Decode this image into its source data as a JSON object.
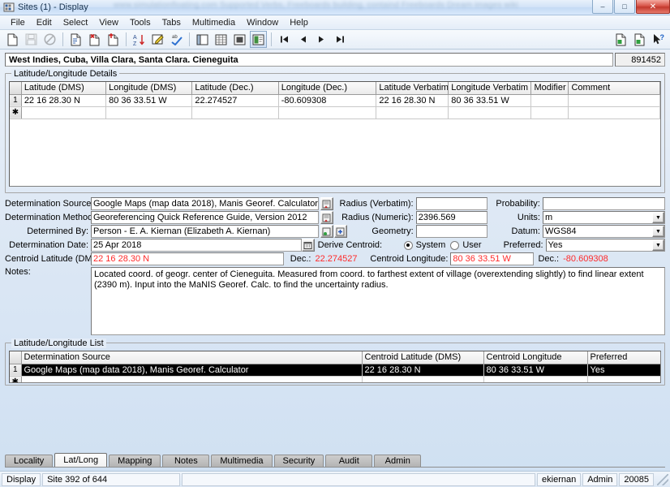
{
  "window": {
    "title": "Sites (1) - Display",
    "app_icon": "specify-app-icon",
    "watermark": "www.simulationfloating.com  Supported Verbs, Freeboards building, containd  Freeboards Dream  images wiki",
    "controls": [
      {
        "name": "minimize",
        "glyph": "–"
      },
      {
        "name": "maximize",
        "glyph": "□"
      },
      {
        "name": "close",
        "glyph": "✕"
      }
    ]
  },
  "menubar": {
    "items": [
      {
        "label": "File"
      },
      {
        "label": "Edit"
      },
      {
        "label": "Select"
      },
      {
        "label": "View"
      },
      {
        "label": "Tools"
      },
      {
        "label": "Tabs"
      },
      {
        "label": "Multimedia"
      },
      {
        "label": "Window"
      },
      {
        "label": "Help"
      }
    ]
  },
  "toolbar": {
    "buttons": [
      {
        "name": "new-record-icon",
        "title": "New"
      },
      {
        "name": "save-record-icon",
        "title": "Save"
      },
      {
        "name": "cancel-icon",
        "title": "Cancel"
      },
      {
        "name": "duplicate-record-icon",
        "title": "Duplicate"
      },
      {
        "name": "delete-record-icon",
        "title": "Delete"
      },
      {
        "name": "remove-record-icon",
        "title": "Remove"
      },
      {
        "name": "sort-icon",
        "title": "Sort"
      },
      {
        "name": "edit-query-icon",
        "title": "Edit Query"
      },
      {
        "name": "spellcheck-icon",
        "title": "Spell Check"
      },
      {
        "name": "form-view-icon",
        "title": "Form View"
      },
      {
        "name": "grid-view-icon",
        "title": "Grid View"
      },
      {
        "name": "report-view-icon",
        "title": "Report View"
      },
      {
        "name": "record-view-icon",
        "title": "Record View"
      },
      {
        "name": "nav-first-icon",
        "title": "First"
      },
      {
        "name": "nav-prev-icon",
        "title": "Previous"
      },
      {
        "name": "nav-next-icon",
        "title": "Next"
      },
      {
        "name": "nav-last-icon",
        "title": "Last"
      }
    ],
    "right_buttons": [
      {
        "name": "export-record-icon",
        "title": "Export"
      },
      {
        "name": "import-record-icon",
        "title": "Import"
      },
      {
        "name": "context-help-icon",
        "title": "Context Help"
      }
    ]
  },
  "header": {
    "locality": "West Indies, Cuba, Villa Clara, Santa Clara. Cieneguita",
    "record_id": "891452"
  },
  "details_group": {
    "title": "Latitude/Longitude Details",
    "columns": [
      "Latitude (DMS)",
      "Longitude (DMS)",
      "Latitude (Dec.)",
      "Longitude (Dec.)",
      "Latitude Verbatim",
      "Longitude Verbatim",
      "Modifier",
      "Comment"
    ],
    "rows": [
      {
        "num": "1",
        "cells": [
          "22 16 28.30 N",
          "80 36 33.51 W",
          "22.274527",
          "-80.609308",
          "22 16 28.30 N",
          "80 36 33.51 W",
          "",
          ""
        ]
      }
    ],
    "new_row_marker": "✱"
  },
  "form": {
    "determination_source": {
      "label": "Determination Source:",
      "value": "Google Maps (map data 2018), Manis Georef. Calculator"
    },
    "determination_method": {
      "label": "Determination Method:",
      "value": "Georeferencing Quick Reference Guide, Version 2012"
    },
    "determined_by": {
      "label": "Determined By:",
      "value": "Person - E. A. Kiernan (Elizabeth A. Kiernan)"
    },
    "determination_date": {
      "label": "Determination Date:",
      "value": "25 Apr 2018"
    },
    "centroid_latitude_dms": {
      "label": "Centroid Latitude (DMS):",
      "value": "22 16 28.30 N"
    },
    "centroid_latitude_dec": {
      "label": "Dec.:",
      "value": "22.274527"
    },
    "centroid_longitude_dms": {
      "label": "Centroid Longitude:",
      "value": "80 36 33.51 W"
    },
    "centroid_longitude_dec": {
      "label": "Dec.:",
      "value": "-80.609308"
    },
    "radius_verbatim": {
      "label": "Radius (Verbatim):",
      "value": ""
    },
    "radius_numeric": {
      "label": "Radius (Numeric):",
      "value": "2396.569"
    },
    "geometry": {
      "label": "Geometry:",
      "value": ""
    },
    "derive_centroid": {
      "label": "Derive Centroid:",
      "option_system": "System",
      "option_user": "User",
      "selected": "System"
    },
    "probability": {
      "label": "Probability:",
      "value": ""
    },
    "units": {
      "label": "Units:",
      "value": "m"
    },
    "datum": {
      "label": "Datum:",
      "value": "WGS84"
    },
    "preferred": {
      "label": "Preferred:",
      "value": "Yes"
    },
    "notes": {
      "label": "Notes:",
      "value": "Located coord. of geogr. center of Cieneguita. Measured from coord. to farthest extent of village (overextending slightly) to find linear extent (2390 m). Input into the MaNIS Georef. Calc. to find the uncertainty radius."
    }
  },
  "list_group": {
    "title": "Latitude/Longitude List",
    "columns": [
      "Determination Source",
      "Centroid Latitude (DMS)",
      "Centroid Longitude",
      "Preferred"
    ],
    "rows": [
      {
        "num": "1",
        "selected": true,
        "cells": [
          "Google Maps (map data 2018), Manis Georef. Calculator",
          "22 16 28.30 N",
          "80 36 33.51 W",
          "Yes"
        ]
      }
    ],
    "new_row_marker": "✱"
  },
  "tabs": {
    "items": [
      {
        "label": "Locality",
        "active": false
      },
      {
        "label": "Lat/Long",
        "active": true
      },
      {
        "label": "Mapping",
        "active": false
      },
      {
        "label": "Notes",
        "active": false
      },
      {
        "label": "Multimedia",
        "active": false
      },
      {
        "label": "Security",
        "active": false
      },
      {
        "label": "Audit",
        "active": false
      },
      {
        "label": "Admin",
        "active": false
      }
    ]
  },
  "statusbar": {
    "mode": "Display",
    "record_position": "Site 392 of 644",
    "user": "ekiernan",
    "role": "Admin",
    "session": "20085"
  },
  "colors": {
    "red_value": "#ff2a2a",
    "selection": "#000000",
    "window_chrome": "#cfe0f2"
  }
}
